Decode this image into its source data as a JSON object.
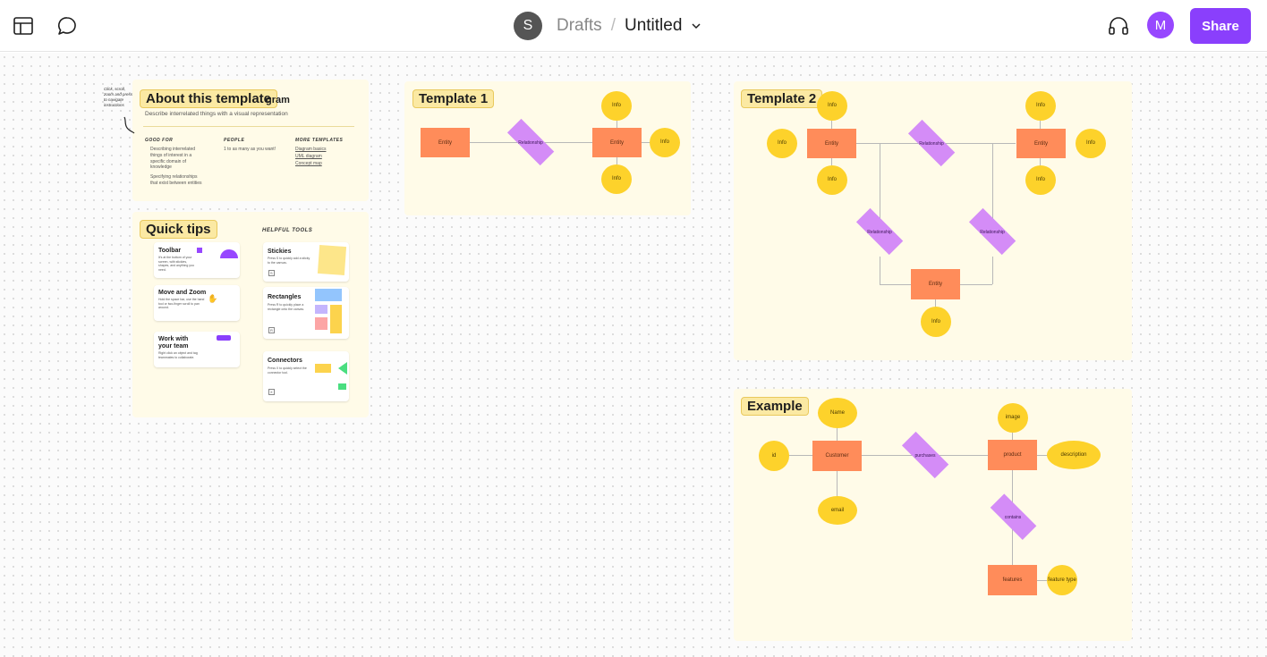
{
  "topbar": {
    "layout_icon": "layout-icon",
    "comment_icon": "comment-icon",
    "workspace_initial": "S",
    "drafts_label": "Drafts",
    "separator": "/",
    "file_title": "Untitled",
    "audio_icon": "headphones-icon",
    "user_initial": "M",
    "share_label": "Share"
  },
  "colors": {
    "accent": "#8a3ffc",
    "entity": "#ff8c5a",
    "relationship": "#d48cf7",
    "attribute": "#fdd22b",
    "section_bg": "#fffbe8",
    "label_bg": "#fbe9a3"
  },
  "about": {
    "label": "About this template",
    "title_tail": "gram",
    "description": "Describe interrelated things with a visual representation",
    "side_note": "Click, scroll, zoom and press to navigate instructions",
    "good_for_heading": "GOOD FOR",
    "good_for_items": [
      "Describing interrelated things of interest in a specific domain of knowledge",
      "Specifying relationships that exist between entities"
    ],
    "people_heading": "PEOPLE",
    "people_text": "1 to as many as you want!",
    "more_heading": "MORE TEMPLATES",
    "more_links": [
      "Diagram basics",
      "UML diagram",
      "Concept map"
    ]
  },
  "tips": {
    "label": "Quick tips",
    "tools_heading": "HELPFUL TOOLS",
    "cards": [
      {
        "title": "Toolbar",
        "text": "It's at the bottom of your screen, with stickies, shapes, and anything you need."
      },
      {
        "title": "Move and Zoom",
        "text": "Hold the space bar, use the hand tool or two-finger scroll to pan around."
      },
      {
        "title": "Work with your team",
        "text": "Right click an object and tag teammates to collaborate."
      }
    ],
    "tools": [
      {
        "title": "Stickies",
        "text": "Press S to quickly add a sticky to the canvas.",
        "key": "S"
      },
      {
        "title": "Rectangles",
        "text": "Press R to quickly place a rectangle onto the canvas.",
        "key": "R"
      },
      {
        "title": "Connectors",
        "text": "Press X to quickly select the connector tool.",
        "key": "X"
      }
    ]
  },
  "template1": {
    "label": "Template 1",
    "entity_a": "Entity",
    "relationship": "Relationship",
    "entity_b": "Entity",
    "attrs": [
      "Info",
      "Info",
      "Info"
    ]
  },
  "template2": {
    "label": "Template 2",
    "entity_left": "Entity",
    "entity_right": "Entity",
    "entity_bottom": "Entity",
    "rel_top": "Relationship",
    "rel_left": "Relationship",
    "rel_right": "Relationship",
    "info": "Info"
  },
  "example": {
    "label": "Example",
    "customer": "Customer",
    "purchases": "purchases",
    "product": "product",
    "contains": "contains",
    "features": "features",
    "attrs": {
      "name": "Name",
      "id": "id",
      "email": "email",
      "image": "image",
      "description": "description",
      "feature_type": "feature type"
    }
  }
}
